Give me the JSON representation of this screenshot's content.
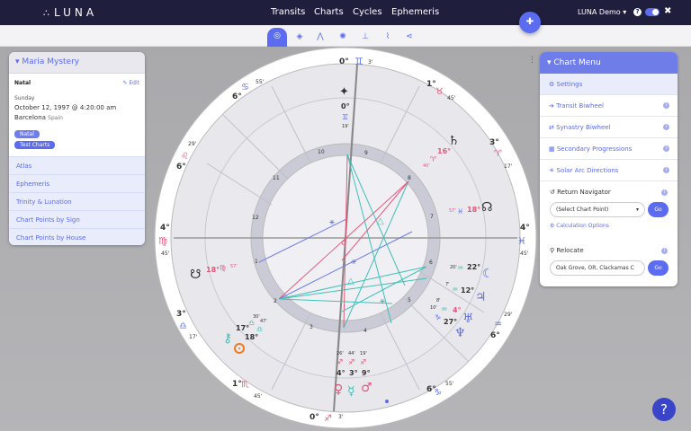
{
  "nav": {
    "logo": "LUNA",
    "links": [
      "Transits",
      "Charts",
      "Cycles",
      "Ephemeris"
    ],
    "user": "LUNA Demo ▾",
    "help": "?"
  },
  "left_panel": {
    "title": "Maria Mystery",
    "type": "Natal",
    "edit": "Edit",
    "day": "Sunday",
    "date": "October 12, 1997 @ 4:20:00 am",
    "city": "Barcelona",
    "country": "Spain",
    "tags": [
      "Natal",
      "Test Charts"
    ],
    "links": [
      "Atlas",
      "Ephemeris",
      "Trinity & Lunation",
      "Chart Points by Sign",
      "Chart Points by House"
    ]
  },
  "right_panel": {
    "title": "Chart Menu",
    "items": [
      "Settings",
      "Transit Biwheel",
      "Synastry Biwheel",
      "Secondary Progressions",
      "Solar Arc Directions"
    ],
    "return_nav": "Return Navigator",
    "select_value": "(Select Chart Point)",
    "go": "Go",
    "calc": "Calculation Options",
    "relocate": "Relocate",
    "location": "Oak Grove, OR, Clackamas C"
  },
  "wheel": {
    "house_numbers": [
      "1",
      "2",
      "3",
      "4",
      "5",
      "6",
      "7",
      "8",
      "9",
      "10",
      "11",
      "12"
    ],
    "cusps": {
      "top": {
        "deg": "0°",
        "sign": "♊",
        "min": "3'"
      },
      "bottom": {
        "deg": "0°",
        "sign": "♐",
        "min": "3'"
      },
      "left": {
        "deg": "4°",
        "sign": "♍",
        "min": "45'"
      },
      "right": {
        "deg": "4°",
        "sign": "♓",
        "min": "45'"
      },
      "upper_left_1": {
        "deg": "6°",
        "sign": "♋",
        "min": "55'"
      },
      "upper_left_2": {
        "deg": "6°",
        "sign": "♌",
        "min": "29'"
      },
      "upper_right_1": {
        "deg": "1°",
        "sign": "♉",
        "min": "45'"
      },
      "upper_right_2": {
        "deg": "3°",
        "sign": "♈",
        "min": "17'"
      },
      "lower_left_1": {
        "deg": "3°",
        "sign": "♎",
        "min": "17'"
      },
      "lower_left_2": {
        "deg": "1°",
        "sign": "♏",
        "min": "45'"
      },
      "lower_right_1": {
        "deg": "6°",
        "sign": "♒",
        "min": "29'"
      },
      "lower_right_2": {
        "deg": "6°",
        "sign": "♑",
        "min": "55'"
      }
    },
    "planets": {
      "mc_point": "0°",
      "mc_sign": "♊",
      "mc_min": "19'",
      "saturn": "16°",
      "saturn_min": "40'",
      "node_s": "18°",
      "node_s_min": "57'",
      "node_n": "18°",
      "node_n_min": "57'",
      "moon": "22°",
      "moon_min": "20'",
      "jupiter": "12°",
      "jupiter_min": "7'",
      "uranus": "4°",
      "uranus_min": "8'",
      "neptune": "27°",
      "neptune_min": "10'",
      "chiron": "17°",
      "chiron_min": "30'",
      "sun": "18°",
      "sun_min": "47'",
      "venus_deg": "4°",
      "venus_min": "26'",
      "mercury_deg": "3°",
      "mercury_min": "44'",
      "mars_deg": "9°",
      "mars_min": "19'"
    }
  }
}
